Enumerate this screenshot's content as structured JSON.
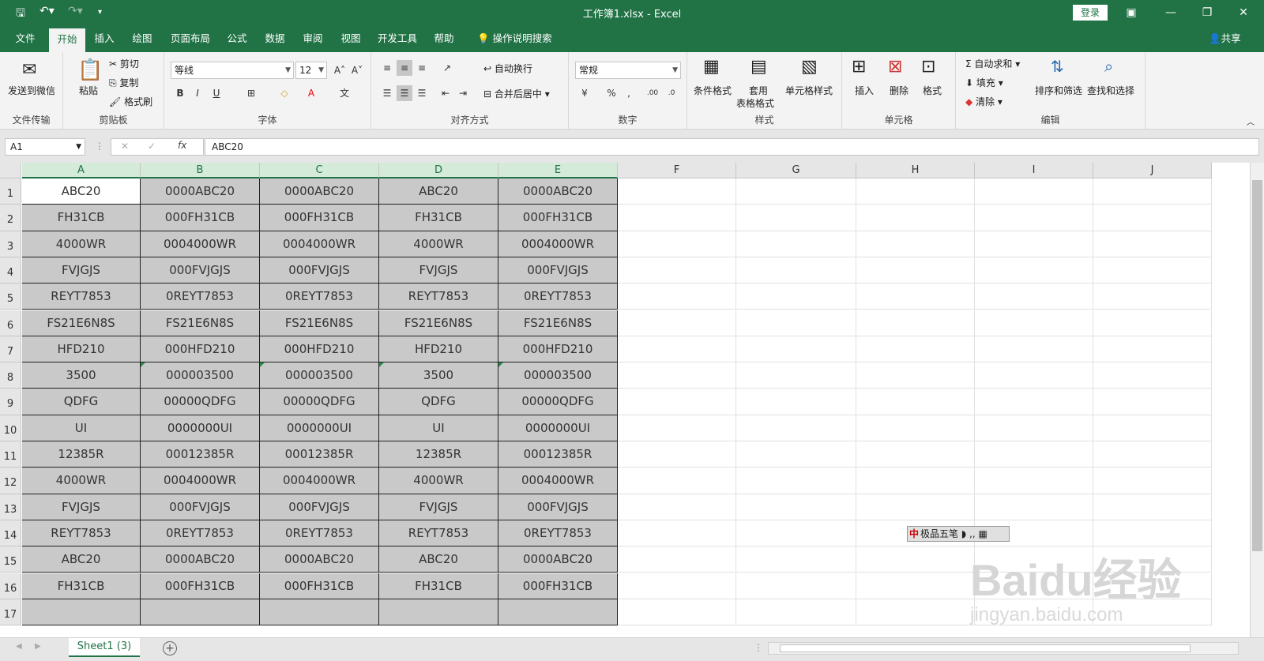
{
  "title": "工作簿1.xlsx  -  Excel",
  "login_label": "登录",
  "share_label": "共享",
  "tabs": [
    "文件",
    "开始",
    "插入",
    "绘图",
    "页面布局",
    "公式",
    "数据",
    "审阅",
    "视图",
    "开发工具",
    "帮助"
  ],
  "active_tab": "开始",
  "search_label": "操作说明搜索",
  "ribbon": {
    "wechat": {
      "button": "发送到微信",
      "group": "文件传输"
    },
    "clipboard": {
      "paste": "粘贴",
      "cut": "剪切",
      "copy": "复制",
      "painter": "格式刷",
      "group": "剪贴板"
    },
    "font": {
      "name": "等线",
      "size": "12",
      "bold": "B",
      "italic": "I",
      "underline": "U",
      "group": "字体"
    },
    "align": {
      "wrap": "自动换行",
      "merge": "合并后居中",
      "group": "对齐方式"
    },
    "number": {
      "format": "常规",
      "group": "数字"
    },
    "styles": {
      "conditional": "条件格式",
      "table1": "套用",
      "table2": "表格格式",
      "cell": "单元格样式",
      "group": "样式"
    },
    "cells": {
      "insert": "插入",
      "delete": "删除",
      "format": "格式",
      "group": "单元格"
    },
    "editing": {
      "autosum": "自动求和",
      "fill": "填充",
      "clear": "清除",
      "sort": "排序和筛选",
      "find": "查找和选择",
      "group": "编辑"
    }
  },
  "name_box": "A1",
  "formula": "ABC20",
  "columns": [
    "A",
    "B",
    "C",
    "D",
    "E",
    "F",
    "G",
    "H",
    "I",
    "J"
  ],
  "rows": [
    "1",
    "2",
    "3",
    "4",
    "5",
    "6",
    "7",
    "8",
    "9",
    "10",
    "11",
    "12",
    "13",
    "14",
    "15",
    "16",
    "17"
  ],
  "cells": [
    [
      "ABC20",
      "0000ABC20",
      "0000ABC20",
      "ABC20",
      "0000ABC20"
    ],
    [
      "FH31CB",
      "000FH31CB",
      "000FH31CB",
      "FH31CB",
      "000FH31CB"
    ],
    [
      "4000WR",
      "0004000WR",
      "0004000WR",
      "4000WR",
      "0004000WR"
    ],
    [
      "FVJGJS",
      "000FVJGJS",
      "000FVJGJS",
      "FVJGJS",
      "000FVJGJS"
    ],
    [
      "REYT7853",
      "0REYT7853",
      "0REYT7853",
      "REYT7853",
      "0REYT7853"
    ],
    [
      "FS21E6N8S",
      "FS21E6N8S",
      "FS21E6N8S",
      "FS21E6N8S",
      "FS21E6N8S"
    ],
    [
      "HFD210",
      "000HFD210",
      "000HFD210",
      "HFD210",
      "000HFD210"
    ],
    [
      "3500",
      "000003500",
      "000003500",
      "3500",
      "000003500"
    ],
    [
      "QDFG",
      "00000QDFG",
      "00000QDFG",
      "QDFG",
      "00000QDFG"
    ],
    [
      "UI",
      "0000000UI",
      "0000000UI",
      "UI",
      "0000000UI"
    ],
    [
      "12385R",
      "00012385R",
      "00012385R",
      "12385R",
      "00012385R"
    ],
    [
      "4000WR",
      "0004000WR",
      "0004000WR",
      "4000WR",
      "0004000WR"
    ],
    [
      "FVJGJS",
      "000FVJGJS",
      "000FVJGJS",
      "FVJGJS",
      "000FVJGJS"
    ],
    [
      "REYT7853",
      "0REYT7853",
      "0REYT7853",
      "REYT7853",
      "0REYT7853"
    ],
    [
      "ABC20",
      "0000ABC20",
      "0000ABC20",
      "ABC20",
      "0000ABC20"
    ],
    [
      "FH31CB",
      "000FH31CB",
      "000FH31CB",
      "FH31CB",
      "000FH31CB"
    ],
    [
      "",
      "",
      "",
      "",
      ""
    ]
  ],
  "sheet_tab": "Sheet1 (3)",
  "ime_label": "极品五笔",
  "watermark": "Baidu经验",
  "watermark_url": "jingyan.baidu.com",
  "colors": {
    "brand": "#217346",
    "selection_fill": "#c9c9c9"
  }
}
